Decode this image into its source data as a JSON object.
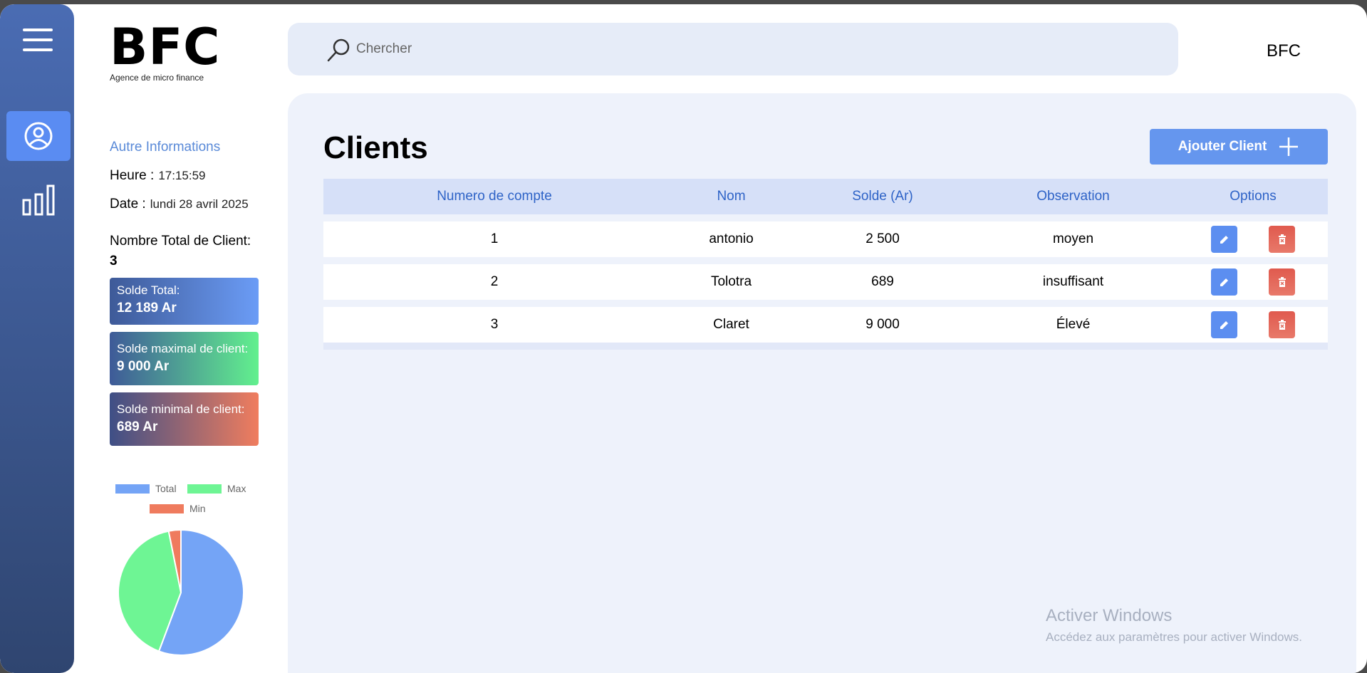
{
  "brand": {
    "title": "BFC",
    "subtitle": "Agence de micro finance"
  },
  "search": {
    "placeholder": "Chercher"
  },
  "top_user": "BFC",
  "nav": [
    {
      "name": "clients",
      "icon": "user-circle-icon",
      "active": true
    },
    {
      "name": "stats",
      "icon": "bar-chart-icon",
      "active": false
    }
  ],
  "info": {
    "heading": "Autre Informations",
    "heure_label": "Heure :",
    "heure_value": "17:15:59",
    "date_label": "Date :",
    "date_value": "lundi 28 avril 2025",
    "count_label": "Nombre Total de Client:",
    "count_value": "3"
  },
  "stats": {
    "total_label": "Solde Total:",
    "total_value": "12 189 Ar",
    "max_label": "Solde maximal de client:",
    "max_value": "9 000 Ar",
    "min_label": "Solde minimal de client:",
    "min_value": "689 Ar"
  },
  "colors": {
    "total": "#74a4f6",
    "max": "#6ef594",
    "min": "#ef7b5e",
    "accent": "#6596ee"
  },
  "chart_data": {
    "type": "pie",
    "categories": [
      "Total",
      "Max",
      "Min"
    ],
    "values": [
      12189,
      9000,
      689
    ],
    "title": "",
    "legend": "top"
  },
  "main": {
    "title": "Clients",
    "add_button_label": "Ajouter Client",
    "columns": [
      "Numero de compte",
      "Nom",
      "Solde (Ar)",
      "Observation",
      "Options"
    ],
    "rows": [
      {
        "numero": "1",
        "nom": "antonio",
        "solde": "2 500",
        "observation": "moyen"
      },
      {
        "numero": "2",
        "nom": "Tolotra",
        "solde": "689",
        "observation": "insuffisant"
      },
      {
        "numero": "3",
        "nom": "Claret",
        "solde": "9 000",
        "observation": "Élevé"
      }
    ]
  },
  "watermark": {
    "line1": "Activer Windows",
    "line2": "Accédez aux paramètres pour activer Windows."
  }
}
